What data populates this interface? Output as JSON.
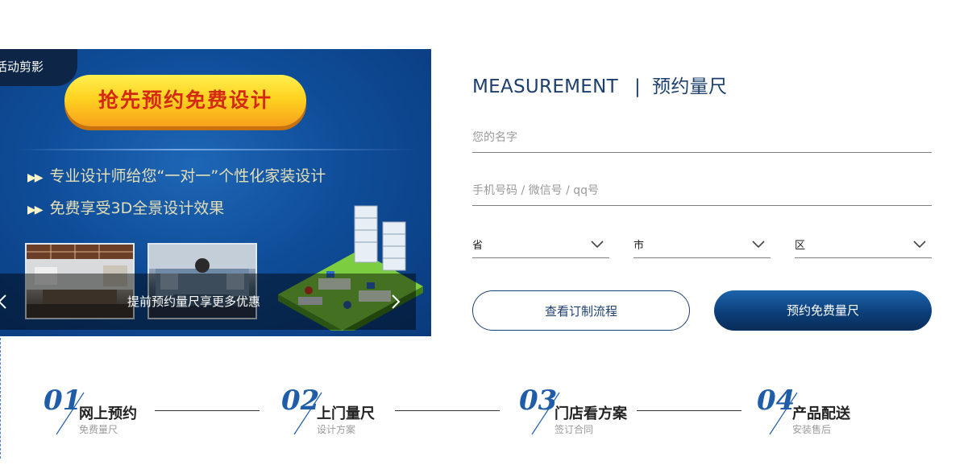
{
  "banner": {
    "tag": "活动剪影",
    "headline": "抢先预约免费设计",
    "features": [
      "专业设计师给您“一对一”个性化家装设计",
      "免费享受3D全景设计效果"
    ],
    "caption": "提前预约量尺享更多优惠"
  },
  "form": {
    "title_en": "MEASUREMENT",
    "title_divider": "|",
    "title_cn": "预约量尺",
    "name_placeholder": "您的名字",
    "contact_placeholder": "手机号码 / 微信号 / qq号",
    "province_label": "省",
    "city_label": "市",
    "district_label": "区",
    "view_process_label": "查看订制流程",
    "book_label": "预约免费量尺"
  },
  "steps": [
    {
      "num": "01",
      "title": "网上预约",
      "sub": "免费量尺"
    },
    {
      "num": "02",
      "title": "上门量尺",
      "sub": "设计方案"
    },
    {
      "num": "03",
      "title": "门店看方案",
      "sub": "签订合同"
    },
    {
      "num": "04",
      "title": "产品配送",
      "sub": "安装售后"
    }
  ],
  "colors": {
    "brand_navy": "#1c3f6e",
    "button_blue": "#0d3f7a",
    "step_number": "#1f5da8",
    "banner_blue": "#0f4d99"
  }
}
